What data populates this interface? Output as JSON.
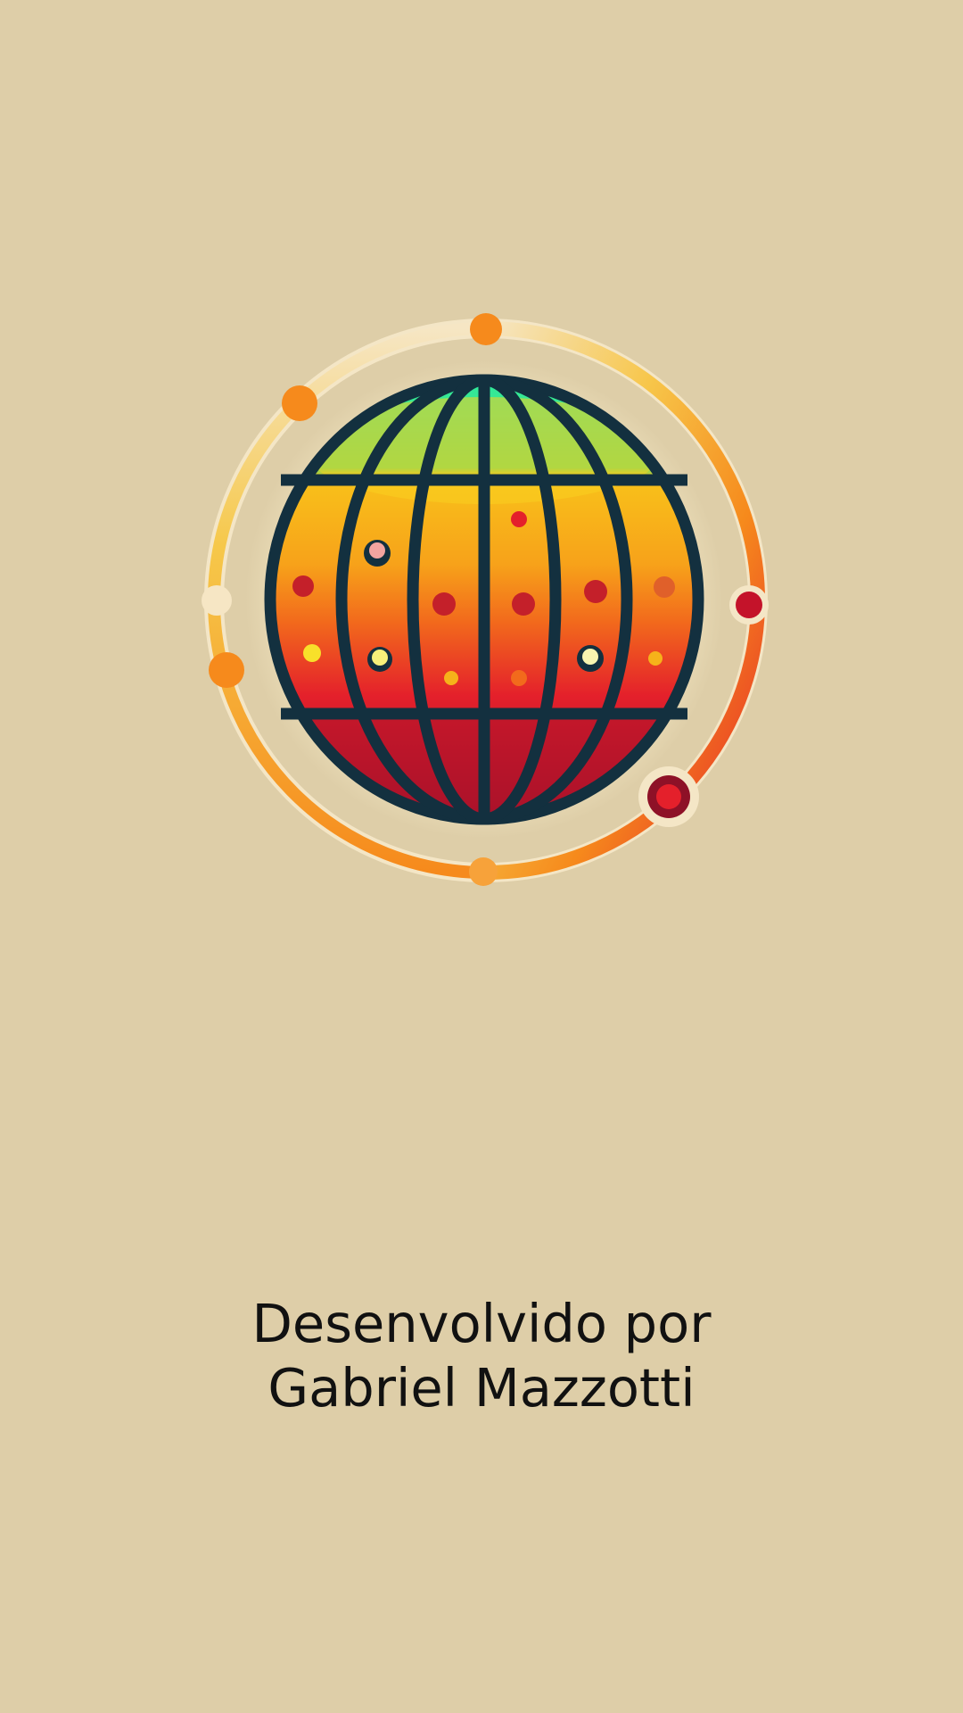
{
  "splash": {
    "credit_line_1": "Desenvolvido por",
    "credit_line_2": "Gabriel Mazzotti",
    "logo_icon": "globe-network-icon"
  },
  "colors": {
    "background": "#DECEA8",
    "text": "#111111",
    "globe_outline": "#13303F",
    "globe_top": "#4ADE7A",
    "globe_band_yellow": "#F6C21A",
    "globe_band_orange": "#F7931A",
    "globe_band_red": "#E4202B",
    "globe_bottom": "#B5132A",
    "ring_light": "#F3E4C2",
    "ring_orange": "#F68A1C",
    "ring_red": "#E4202B"
  }
}
